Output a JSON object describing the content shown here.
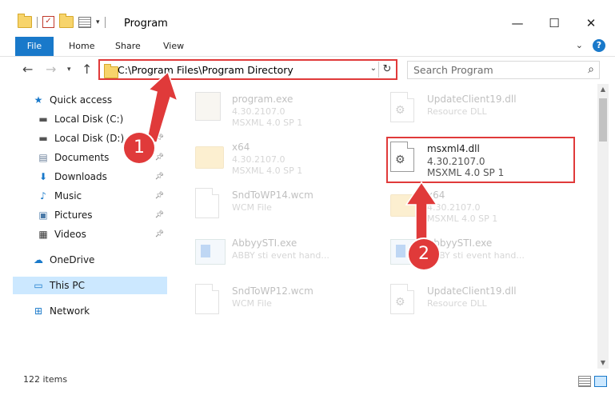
{
  "window": {
    "title": "Program",
    "minimize": "—",
    "maximize": "☐",
    "close": "✕"
  },
  "ribbon": {
    "tabs": [
      "File",
      "Home",
      "Share",
      "View"
    ]
  },
  "address": {
    "path": "C:\\Program Files\\Program Directory"
  },
  "search": {
    "placeholder": "Search Program"
  },
  "sidebar": {
    "items": [
      {
        "label": "Quick access",
        "icon": "star-icon",
        "pinned": false
      },
      {
        "label": "Local Disk (C:)",
        "icon": "drive-icon",
        "pinned": true
      },
      {
        "label": "Local Disk (D:)",
        "icon": "drive-icon",
        "pinned": true
      },
      {
        "label": "Documents",
        "icon": "documents-icon",
        "pinned": true
      },
      {
        "label": "Downloads",
        "icon": "download-icon",
        "pinned": true
      },
      {
        "label": "Music",
        "icon": "music-icon",
        "pinned": true
      },
      {
        "label": "Pictures",
        "icon": "pictures-icon",
        "pinned": true
      },
      {
        "label": "Videos",
        "icon": "videos-icon",
        "pinned": true
      },
      {
        "label": "OneDrive",
        "icon": "cloud-icon",
        "pinned": false
      },
      {
        "label": "This PC",
        "icon": "computer-icon",
        "pinned": false,
        "selected": true
      },
      {
        "label": "Network",
        "icon": "network-icon",
        "pinned": false
      }
    ]
  },
  "files": [
    {
      "name": "program.exe",
      "line1": "4.30.2107.0",
      "line2": "MSXML 4.0 SP 1",
      "kind": "exe",
      "faded": true
    },
    {
      "name": "UpdateClient19.dll",
      "line1": "Resource DLL",
      "line2": "",
      "kind": "dll",
      "faded": true
    },
    {
      "name": "x64",
      "line1": "4.30.2107.0",
      "line2": "MSXML 4.0 SP 1",
      "kind": "folder",
      "faded": true
    },
    {
      "name": "msxml4.dll",
      "line1": "4.30.2107.0",
      "line2": "MSXML 4.0 SP 1",
      "kind": "dll",
      "faded": false
    },
    {
      "name": "SndToWP14.wcm",
      "line1": "WCM File",
      "line2": "",
      "kind": "doc",
      "faded": true
    },
    {
      "name": "x64",
      "line1": "4.30.2107.0",
      "line2": "MSXML 4.0 SP 1",
      "kind": "folder",
      "faded": true
    },
    {
      "name": "AbbyySTI.exe",
      "line1": "ABBY sti event hand...",
      "line2": "",
      "kind": "win",
      "faded": true
    },
    {
      "name": "AbbyySTI.exe",
      "line1": "ABBY sti event hand...",
      "line2": "",
      "kind": "win",
      "faded": true
    },
    {
      "name": "SndToWP12.wcm",
      "line1": "WCM File",
      "line2": "",
      "kind": "doc",
      "faded": true
    },
    {
      "name": "UpdateClient19.dll",
      "line1": "Resource DLL",
      "line2": "",
      "kind": "dll",
      "faded": true
    }
  ],
  "status": {
    "count": "122 items"
  },
  "annotations": {
    "step1": "1",
    "step2": "2",
    "color": "#e03a3a"
  }
}
